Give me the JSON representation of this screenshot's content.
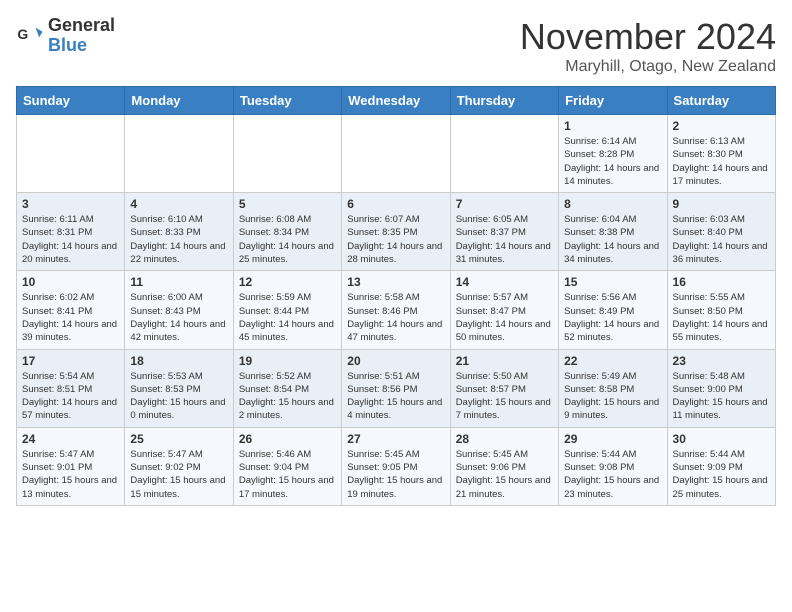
{
  "logo": {
    "line1": "General",
    "line2": "Blue"
  },
  "title": "November 2024",
  "location": "Maryhill, Otago, New Zealand",
  "days_of_week": [
    "Sunday",
    "Monday",
    "Tuesday",
    "Wednesday",
    "Thursday",
    "Friday",
    "Saturday"
  ],
  "weeks": [
    [
      {
        "day": "",
        "info": ""
      },
      {
        "day": "",
        "info": ""
      },
      {
        "day": "",
        "info": ""
      },
      {
        "day": "",
        "info": ""
      },
      {
        "day": "",
        "info": ""
      },
      {
        "day": "1",
        "info": "Sunrise: 6:14 AM\nSunset: 8:28 PM\nDaylight: 14 hours and 14 minutes."
      },
      {
        "day": "2",
        "info": "Sunrise: 6:13 AM\nSunset: 8:30 PM\nDaylight: 14 hours and 17 minutes."
      }
    ],
    [
      {
        "day": "3",
        "info": "Sunrise: 6:11 AM\nSunset: 8:31 PM\nDaylight: 14 hours and 20 minutes."
      },
      {
        "day": "4",
        "info": "Sunrise: 6:10 AM\nSunset: 8:33 PM\nDaylight: 14 hours and 22 minutes."
      },
      {
        "day": "5",
        "info": "Sunrise: 6:08 AM\nSunset: 8:34 PM\nDaylight: 14 hours and 25 minutes."
      },
      {
        "day": "6",
        "info": "Sunrise: 6:07 AM\nSunset: 8:35 PM\nDaylight: 14 hours and 28 minutes."
      },
      {
        "day": "7",
        "info": "Sunrise: 6:05 AM\nSunset: 8:37 PM\nDaylight: 14 hours and 31 minutes."
      },
      {
        "day": "8",
        "info": "Sunrise: 6:04 AM\nSunset: 8:38 PM\nDaylight: 14 hours and 34 minutes."
      },
      {
        "day": "9",
        "info": "Sunrise: 6:03 AM\nSunset: 8:40 PM\nDaylight: 14 hours and 36 minutes."
      }
    ],
    [
      {
        "day": "10",
        "info": "Sunrise: 6:02 AM\nSunset: 8:41 PM\nDaylight: 14 hours and 39 minutes."
      },
      {
        "day": "11",
        "info": "Sunrise: 6:00 AM\nSunset: 8:43 PM\nDaylight: 14 hours and 42 minutes."
      },
      {
        "day": "12",
        "info": "Sunrise: 5:59 AM\nSunset: 8:44 PM\nDaylight: 14 hours and 45 minutes."
      },
      {
        "day": "13",
        "info": "Sunrise: 5:58 AM\nSunset: 8:46 PM\nDaylight: 14 hours and 47 minutes."
      },
      {
        "day": "14",
        "info": "Sunrise: 5:57 AM\nSunset: 8:47 PM\nDaylight: 14 hours and 50 minutes."
      },
      {
        "day": "15",
        "info": "Sunrise: 5:56 AM\nSunset: 8:49 PM\nDaylight: 14 hours and 52 minutes."
      },
      {
        "day": "16",
        "info": "Sunrise: 5:55 AM\nSunset: 8:50 PM\nDaylight: 14 hours and 55 minutes."
      }
    ],
    [
      {
        "day": "17",
        "info": "Sunrise: 5:54 AM\nSunset: 8:51 PM\nDaylight: 14 hours and 57 minutes."
      },
      {
        "day": "18",
        "info": "Sunrise: 5:53 AM\nSunset: 8:53 PM\nDaylight: 15 hours and 0 minutes."
      },
      {
        "day": "19",
        "info": "Sunrise: 5:52 AM\nSunset: 8:54 PM\nDaylight: 15 hours and 2 minutes."
      },
      {
        "day": "20",
        "info": "Sunrise: 5:51 AM\nSunset: 8:56 PM\nDaylight: 15 hours and 4 minutes."
      },
      {
        "day": "21",
        "info": "Sunrise: 5:50 AM\nSunset: 8:57 PM\nDaylight: 15 hours and 7 minutes."
      },
      {
        "day": "22",
        "info": "Sunrise: 5:49 AM\nSunset: 8:58 PM\nDaylight: 15 hours and 9 minutes."
      },
      {
        "day": "23",
        "info": "Sunrise: 5:48 AM\nSunset: 9:00 PM\nDaylight: 15 hours and 11 minutes."
      }
    ],
    [
      {
        "day": "24",
        "info": "Sunrise: 5:47 AM\nSunset: 9:01 PM\nDaylight: 15 hours and 13 minutes."
      },
      {
        "day": "25",
        "info": "Sunrise: 5:47 AM\nSunset: 9:02 PM\nDaylight: 15 hours and 15 minutes."
      },
      {
        "day": "26",
        "info": "Sunrise: 5:46 AM\nSunset: 9:04 PM\nDaylight: 15 hours and 17 minutes."
      },
      {
        "day": "27",
        "info": "Sunrise: 5:45 AM\nSunset: 9:05 PM\nDaylight: 15 hours and 19 minutes."
      },
      {
        "day": "28",
        "info": "Sunrise: 5:45 AM\nSunset: 9:06 PM\nDaylight: 15 hours and 21 minutes."
      },
      {
        "day": "29",
        "info": "Sunrise: 5:44 AM\nSunset: 9:08 PM\nDaylight: 15 hours and 23 minutes."
      },
      {
        "day": "30",
        "info": "Sunrise: 5:44 AM\nSunset: 9:09 PM\nDaylight: 15 hours and 25 minutes."
      }
    ]
  ]
}
